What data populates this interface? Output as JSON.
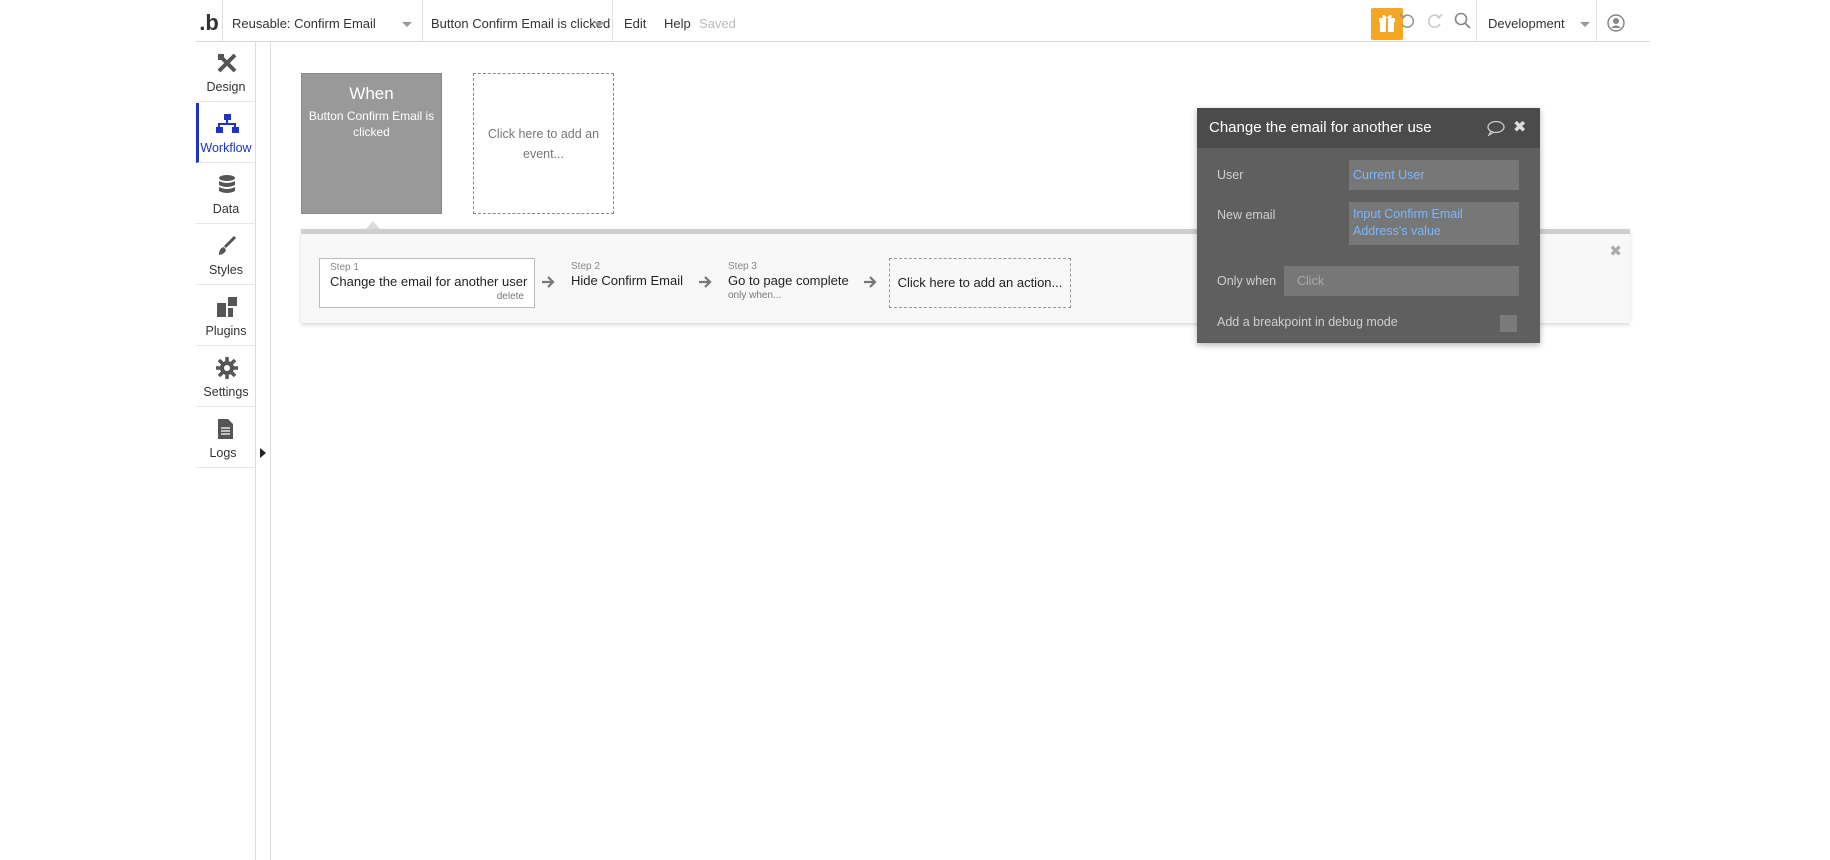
{
  "topbar": {
    "logo": ".b",
    "page_selector": "Reusable: Confirm Email",
    "event_selector": "Button Confirm Email is clicked",
    "edit": "Edit",
    "help": "Help",
    "status": "Saved",
    "environment": "Development"
  },
  "sidebar": {
    "items": [
      {
        "label": "Design"
      },
      {
        "label": "Workflow"
      },
      {
        "label": "Data"
      },
      {
        "label": "Styles"
      },
      {
        "label": "Plugins"
      },
      {
        "label": "Settings"
      },
      {
        "label": "Logs"
      }
    ]
  },
  "event": {
    "when": "When",
    "description": "Button Confirm Email is clicked",
    "add_event": "Click here to add an event..."
  },
  "actions": {
    "steps": [
      {
        "num": "Step 1",
        "name": "Change the email for another user",
        "extra": "delete"
      },
      {
        "num": "Step 2",
        "name": "Hide Confirm Email",
        "extra": ""
      },
      {
        "num": "Step 3",
        "name": "Go to page complete",
        "extra": "only when..."
      }
    ],
    "add_action": "Click here to add an action..."
  },
  "property_editor": {
    "title": "Change the email for another use",
    "user_label": "User",
    "user_value": "Current User",
    "email_label": "New email",
    "email_value": "Input Confirm Email Address's value",
    "only_when_label": "Only when",
    "only_when_placeholder": "Click",
    "breakpoint_label": "Add a breakpoint in debug mode"
  },
  "colors": {
    "accent": "#1c33c4",
    "gift": "#f5a623",
    "editor_bg": "#5f5f5f",
    "field_value": "#7ab7ff"
  }
}
